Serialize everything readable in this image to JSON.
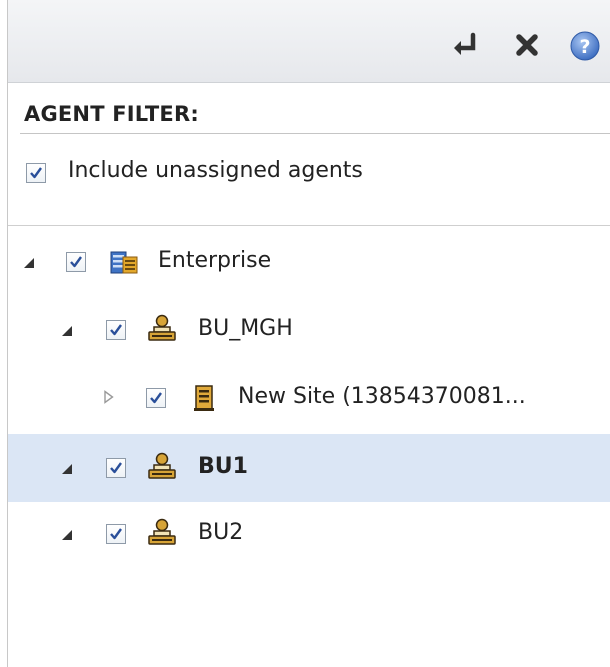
{
  "toolbar": {
    "icons": [
      "enter-icon",
      "close-icon",
      "help-icon"
    ]
  },
  "filter": {
    "title": "AGENT FILTER:",
    "include_unassigned": {
      "label": "Include unassigned agents",
      "checked": true
    }
  },
  "tree": {
    "nodes": [
      {
        "label": "Enterprise",
        "icon": "enterprise-icon",
        "expanded": true,
        "checked": true,
        "selected": false
      },
      {
        "label": "BU_MGH",
        "icon": "business-unit-icon",
        "expanded": true,
        "checked": true,
        "selected": false
      },
      {
        "label": "New Site (13854370081...",
        "icon": "site-icon",
        "expanded": false,
        "checked": true,
        "selected": false
      },
      {
        "label": "BU1",
        "icon": "business-unit-icon",
        "expanded": true,
        "checked": true,
        "selected": true
      },
      {
        "label": "BU2",
        "icon": "business-unit-icon",
        "expanded": true,
        "checked": true,
        "selected": false
      }
    ]
  },
  "colors": {
    "selection": "#dbe6f5",
    "checkmark": "#2a4f9a",
    "help": "#4a78c8"
  }
}
